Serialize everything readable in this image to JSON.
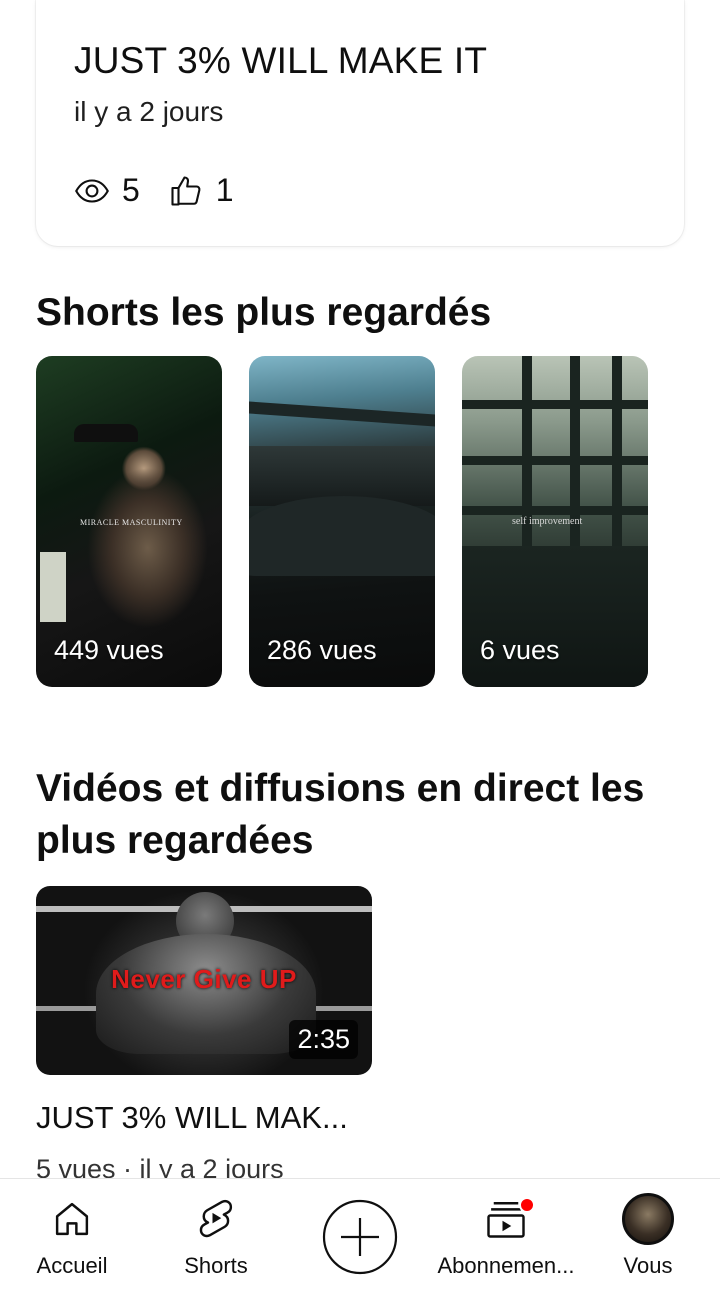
{
  "post": {
    "title": "JUST 3% WILL MAKE IT",
    "time": "il y a 2 jours",
    "views": "5",
    "likes": "1"
  },
  "shorts_section": {
    "title": "Shorts les plus regardés",
    "items": [
      {
        "views": "449 vues",
        "overlay_text": "MIRACLE MASCULINITY"
      },
      {
        "views": "286 vues"
      },
      {
        "views": "6 vues",
        "overlay_text": "self improvement"
      }
    ]
  },
  "videos_section": {
    "title": "Vidéos et diffusions en direct les plus regardées",
    "video": {
      "thumb_text": "Never Give UP",
      "duration": "2:35",
      "title": "JUST 3% WILL MAK...",
      "meta": "5 vues · il y a 2 jours"
    }
  },
  "nav": {
    "items": [
      {
        "label": "Accueil",
        "icon": "home-icon"
      },
      {
        "label": "Shorts",
        "icon": "shorts-icon"
      },
      {
        "label": "",
        "icon": "create-icon"
      },
      {
        "label": "Abonnemen...",
        "icon": "subscriptions-icon"
      },
      {
        "label": "Vous",
        "icon": "avatar"
      }
    ]
  }
}
